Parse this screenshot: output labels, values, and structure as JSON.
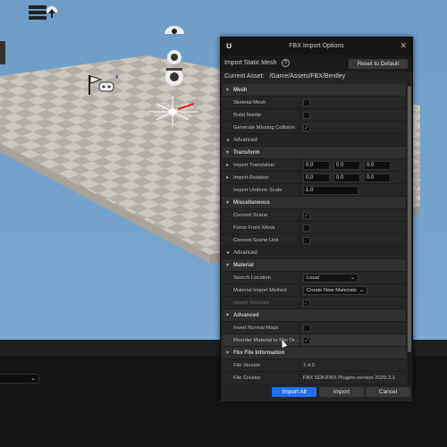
{
  "dialog": {
    "title": "FBX Import Options",
    "subtitle": "Import Static Mesh",
    "reset_label": "Reset to Default",
    "current_asset_label": "Current Asset:",
    "current_asset_value": "/Game/Assets/FBX/Bentley",
    "sections": {
      "mesh": "Mesh",
      "transform": "Transform",
      "misc": "Miscellaneous",
      "material": "Material",
      "advanced": "Advanced",
      "fbx_info": "Fbx File Information"
    },
    "mesh": {
      "skeletal_mesh": "Skeletal Mesh",
      "build_nanite": "Build Nanite",
      "gen_collision": "Generate Missing Collision",
      "advanced": "Advanced"
    },
    "transform": {
      "translation": "Import Translation",
      "rotation": "Import Rotation",
      "uniform_scale": "Import Uniform Scale",
      "t_x": "0.0",
      "t_y": "0.0",
      "t_z": "0.0",
      "r_x": "0.0",
      "r_y": "0.0",
      "r_z": "0.0",
      "scale": "1.0"
    },
    "misc": {
      "convert_scene": "Convert Scene",
      "force_front_x": "Force Front XAxis",
      "convert_scene_unit": "Convert Scene Unit",
      "advanced": "Advanced"
    },
    "material": {
      "search_location": "Search Location",
      "search_location_value": "Local",
      "material_import_method": "Material Import Method",
      "material_import_method_value": "Create New Materials",
      "import_textures": "Import Textures"
    },
    "advanced": {
      "invert_normal_maps": "Invert Normal Maps",
      "reorder_material": "Reorder Material to Fbx Or..."
    },
    "fbx_info": {
      "file_version_label": "File Version",
      "file_version_value": "7.4.0",
      "file_creator_label": "File Creator",
      "file_creator_value": "FBX SDK/FBX Plugins version 2020.3.1"
    },
    "buttons": {
      "import_all": "Import All",
      "import": "Import",
      "cancel": "Cancel"
    }
  },
  "colors": {
    "accent": "#1f6ff0",
    "viewport_sky": "#6f9fc9",
    "dialog_bg": "#242424"
  }
}
